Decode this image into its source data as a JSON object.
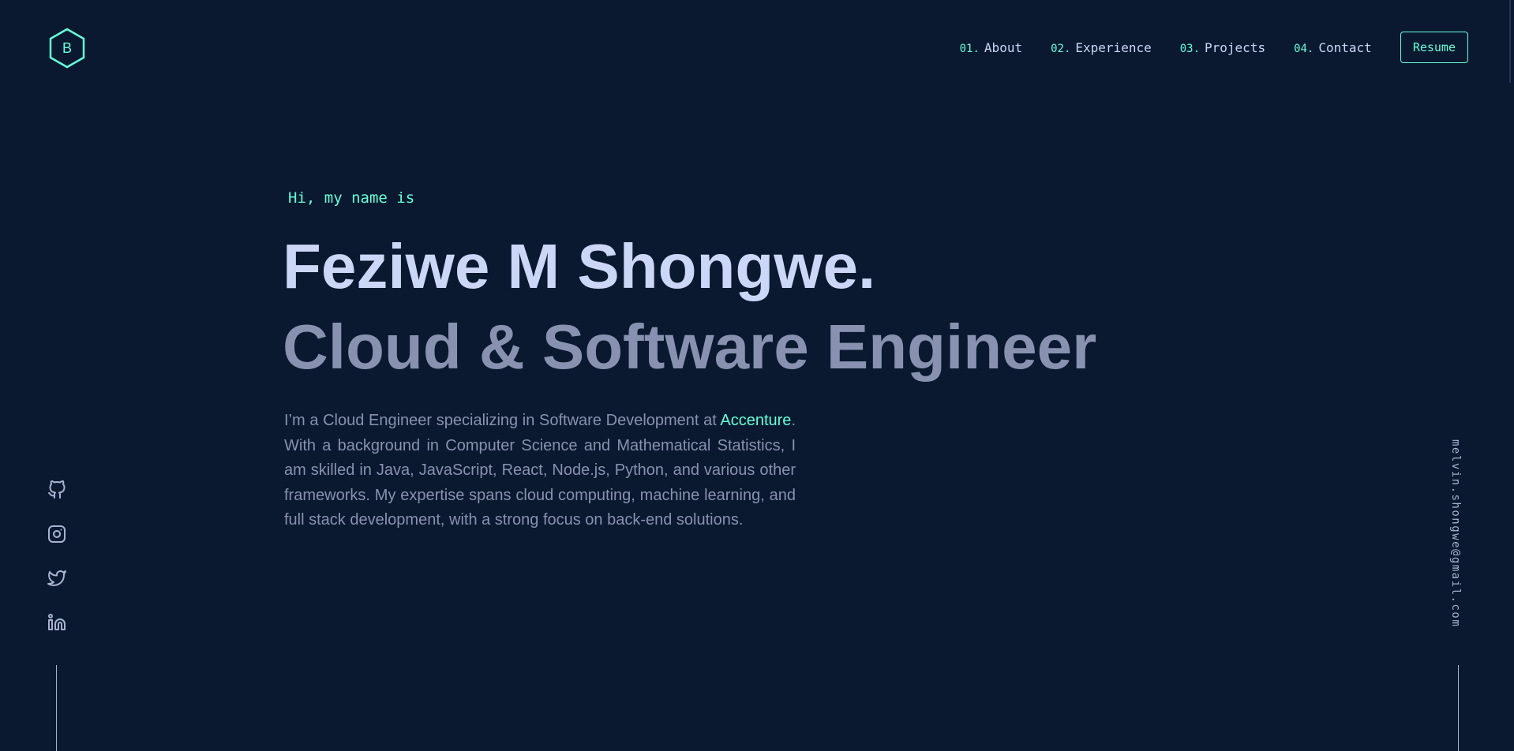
{
  "logo": {
    "letter": "B"
  },
  "nav": {
    "items": [
      {
        "num": "01.",
        "label": "About"
      },
      {
        "num": "02.",
        "label": "Experience"
      },
      {
        "num": "03.",
        "label": "Projects"
      },
      {
        "num": "04.",
        "label": "Contact"
      }
    ],
    "resume_label": "Resume"
  },
  "hero": {
    "greeting": "Hi, my name is",
    "name": "Feziwe M Shongwe.",
    "tagline": "Cloud & Software Engineer",
    "bio_before": "I’m a Cloud Engineer specializing in Software Development at ",
    "bio_accent": "Accenture",
    "bio_after": ". With a background in Computer Science and Mathematical Statistics, I am skilled in Java, JavaScript, React, Node.js, Python, and various other frameworks. My expertise spans cloud computing, machine learning, and full stack development, with a strong focus on back-end solutions."
  },
  "social": [
    "github-icon",
    "instagram-icon",
    "twitter-icon",
    "linkedin-icon"
  ],
  "email": "melvin.shongwe@gmail.com",
  "colors": {
    "background": "#0a192f",
    "accent": "#64ffda",
    "heading": "#ccd6f6",
    "text": "#8892b0"
  }
}
